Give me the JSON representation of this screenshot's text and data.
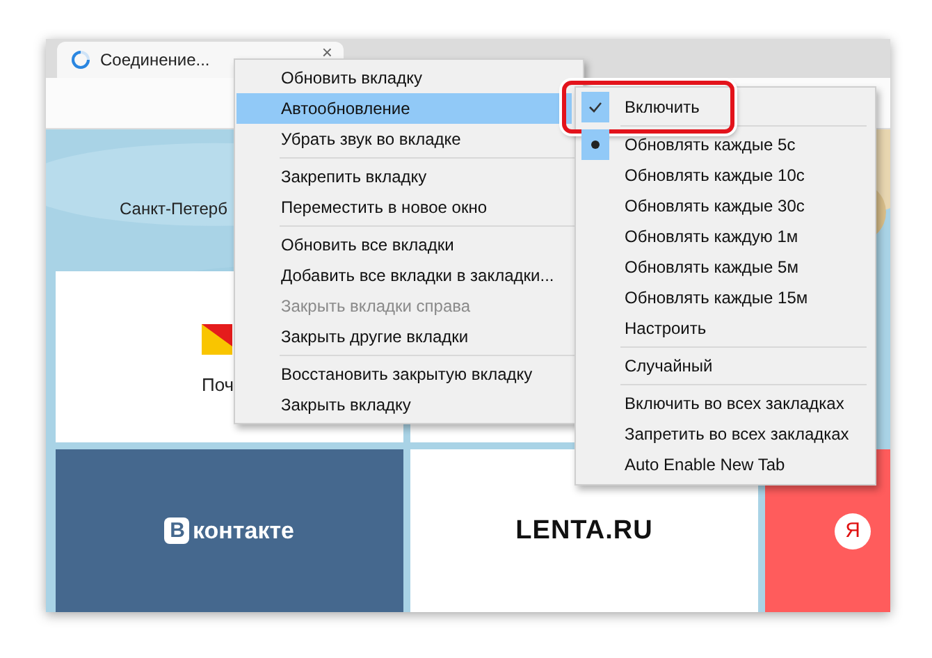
{
  "tab": {
    "title": "Соединение...",
    "loading": true,
    "close": "×"
  },
  "page": {
    "city": "Санкт-Петерб",
    "tile_rows": [
      [
        {
          "kind": "mail",
          "label": "Поч"
        },
        {
          "kind": "blank"
        }
      ],
      [
        {
          "kind": "vk",
          "logo": "В",
          "label": "контакте"
        },
        {
          "kind": "lenta",
          "label": "LENTA.RU"
        },
        {
          "kind": "yandex",
          "logo": "Я"
        }
      ]
    ]
  },
  "menu": {
    "groups": [
      [
        {
          "label": "Обновить вкладку",
          "highlighted": false,
          "disabled": false,
          "submenu": false
        },
        {
          "label": "Автообновление",
          "highlighted": true,
          "disabled": false,
          "submenu": true
        },
        {
          "label": "Убрать звук во вкладке",
          "highlighted": false,
          "disabled": false,
          "submenu": false
        }
      ],
      [
        {
          "label": "Закрепить вкладку",
          "highlighted": false,
          "disabled": false,
          "submenu": false
        },
        {
          "label": "Переместить в новое окно",
          "highlighted": false,
          "disabled": false,
          "submenu": false
        }
      ],
      [
        {
          "label": "Обновить все вкладки",
          "highlighted": false,
          "disabled": false,
          "submenu": false
        },
        {
          "label": "Добавить все вкладки в закладки...",
          "highlighted": false,
          "disabled": false,
          "submenu": false
        },
        {
          "label": "Закрыть вкладки справа",
          "highlighted": false,
          "disabled": true,
          "submenu": false
        },
        {
          "label": "Закрыть другие вкладки",
          "highlighted": false,
          "disabled": false,
          "submenu": false
        }
      ],
      [
        {
          "label": "Восстановить закрытую вкладку",
          "highlighted": false,
          "disabled": false,
          "submenu": false
        },
        {
          "label": "Закрыть вкладку",
          "highlighted": false,
          "disabled": false,
          "submenu": false
        }
      ]
    ]
  },
  "submenu": {
    "groups": [
      [
        {
          "kind": "check",
          "label": "Включить",
          "checked": true,
          "emphasized": true
        }
      ],
      [
        {
          "kind": "radio",
          "label": "Обновлять каждые 5с",
          "checked": true,
          "emphasized": false
        },
        {
          "kind": "radio",
          "label": "Обновлять каждые 10с",
          "checked": false,
          "emphasized": false
        },
        {
          "kind": "radio",
          "label": "Обновлять каждые 30с",
          "checked": false,
          "emphasized": false
        },
        {
          "kind": "radio",
          "label": "Обновлять каждую 1м",
          "checked": false,
          "emphasized": false
        },
        {
          "kind": "radio",
          "label": "Обновлять каждые 5м",
          "checked": false,
          "emphasized": false
        },
        {
          "kind": "radio",
          "label": "Обновлять каждые 15м",
          "checked": false,
          "emphasized": false
        },
        {
          "kind": "plain",
          "label": "Настроить",
          "emphasized": false
        }
      ],
      [
        {
          "kind": "plain",
          "label": "Случайный",
          "emphasized": false
        }
      ],
      [
        {
          "kind": "plain",
          "label": "Включить во всех закладках",
          "emphasized": false
        },
        {
          "kind": "plain",
          "label": "Запретить во всех закладках",
          "emphasized": false
        },
        {
          "kind": "plain",
          "label": "Auto Enable New Tab",
          "emphasized": false
        }
      ]
    ]
  }
}
